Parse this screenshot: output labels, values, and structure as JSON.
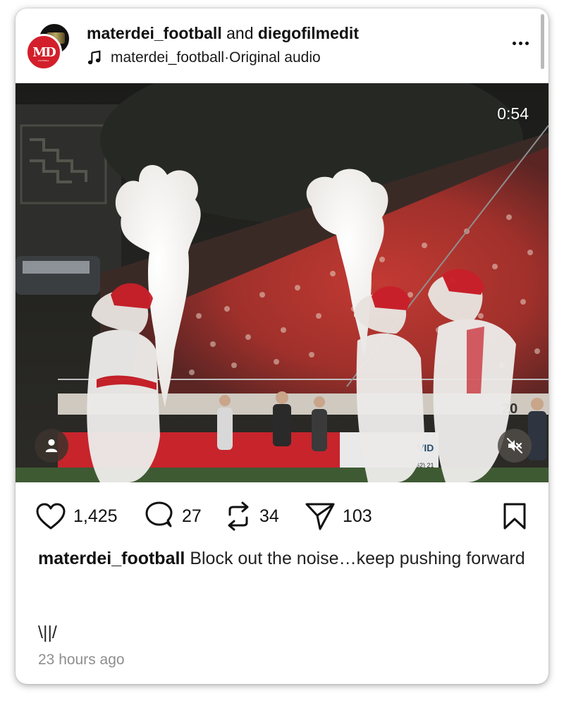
{
  "post": {
    "author": "materdei_football",
    "joiner": " and ",
    "collaborator": "diegofilmedit",
    "audio_owner": "materdei_football",
    "audio_separator": " · ",
    "audio_label": "Original audio",
    "avatar_monogram": "MD",
    "avatar_subtext": "FOOTBALL"
  },
  "media": {
    "duration": "0:54",
    "sign_number": "20",
    "banner_text": "VID",
    "banner_phone": "562) 21"
  },
  "actions": {
    "likes": "1,425",
    "comments": "27",
    "reposts": "34",
    "shares": "103"
  },
  "caption": {
    "username": "materdei_football",
    "text": "Block out the noise…keep pushing forward",
    "extra_line": "\\||/",
    "time_ago": "23 hours ago"
  },
  "icons": {
    "music": "music-note-icon",
    "more": "more-options-icon",
    "like": "heart-icon",
    "comment": "comment-bubble-icon",
    "repost": "repost-icon",
    "share": "paper-plane-icon",
    "bookmark": "bookmark-icon",
    "user_tag": "person-icon",
    "mute": "speaker-muted-icon"
  },
  "colors": {
    "brand_red": "#d31f2b",
    "text": "#111111",
    "muted_text": "#8e8e8e"
  }
}
